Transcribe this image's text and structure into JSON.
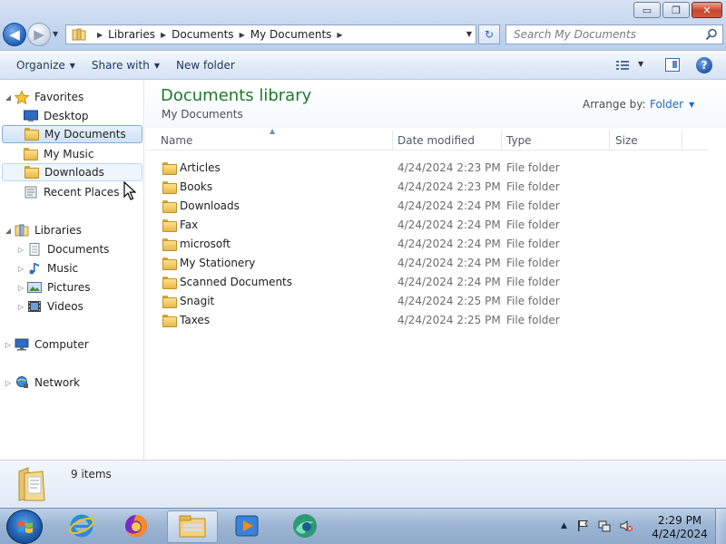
{
  "window": {
    "controls": {
      "minimize": "▭",
      "maximize": "❐",
      "close": "✕"
    },
    "nav": {
      "back": "◀",
      "forward": "▶",
      "recent_dropdown": "▼"
    },
    "breadcrumb": [
      "Libraries",
      "Documents",
      "My Documents"
    ],
    "address_dropdown": "▼",
    "refresh": "↻",
    "search_placeholder": "Search My Documents"
  },
  "toolbar": {
    "organize": "Organize",
    "share_with": "Share with",
    "new_folder": "New folder",
    "dropdown_arrow": "▼"
  },
  "navpane": {
    "favorites": {
      "label": "Favorites",
      "items": [
        "Desktop",
        "My Documents",
        "My Music",
        "Downloads",
        "Recent Places"
      ],
      "selected": "My Documents"
    },
    "libraries": {
      "label": "Libraries",
      "items": [
        "Documents",
        "Music",
        "Pictures",
        "Videos"
      ]
    },
    "computer": "Computer",
    "network": "Network"
  },
  "library": {
    "title": "Documents library",
    "subtitle": "My Documents",
    "arrange_label": "Arrange by:",
    "arrange_value": "Folder"
  },
  "columns": {
    "name": "Name",
    "date_modified": "Date modified",
    "type": "Type",
    "size": "Size",
    "sort_indicator": "▲"
  },
  "files": [
    {
      "name": "Articles",
      "date": "4/24/2024 2:23 PM",
      "type": "File folder"
    },
    {
      "name": "Books",
      "date": "4/24/2024 2:23 PM",
      "type": "File folder"
    },
    {
      "name": "Downloads",
      "date": "4/24/2024 2:24 PM",
      "type": "File folder"
    },
    {
      "name": "Fax",
      "date": "4/24/2024 2:24 PM",
      "type": "File folder"
    },
    {
      "name": "microsoft",
      "date": "4/24/2024 2:24 PM",
      "type": "File folder"
    },
    {
      "name": "My Stationery",
      "date": "4/24/2024 2:24 PM",
      "type": "File folder"
    },
    {
      "name": "Scanned Documents",
      "date": "4/24/2024 2:24 PM",
      "type": "File folder"
    },
    {
      "name": "Snagit",
      "date": "4/24/2024 2:25 PM",
      "type": "File folder"
    },
    {
      "name": "Taxes",
      "date": "4/24/2024 2:25 PM",
      "type": "File folder"
    }
  ],
  "details": {
    "count": "9 items"
  },
  "taskbar": {
    "apps": [
      "internet-explorer",
      "firefox",
      "windows-explorer",
      "media-player",
      "browser-app"
    ],
    "clock_time": "2:29 PM",
    "clock_date": "4/24/2024",
    "tray_arrow": "▲"
  },
  "colors": {
    "accent": "#1d7a27",
    "link": "#1e6ac8",
    "selection": "#cfe2f8"
  }
}
